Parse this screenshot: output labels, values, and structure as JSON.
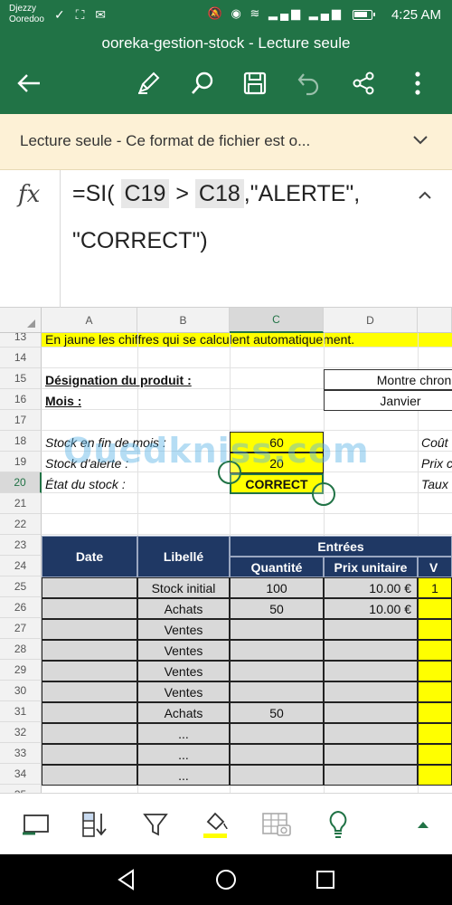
{
  "status_bar": {
    "carrier_1": "Djezzy",
    "carrier_2": "Ooredoo",
    "time": "4:25 AM",
    "battery_level": 0.8
  },
  "app_bar": {
    "title": "ooreka-gestion-stock - Lecture seule"
  },
  "banner": {
    "text": "Lecture seule - Ce format de fichier est o..."
  },
  "formula_bar": {
    "fx_label": "fx",
    "line1_prefix": "=SI(",
    "ref1": "C19",
    "operator": ">",
    "ref2": "C18",
    "line1_suffix": ",\"ALERTE\",",
    "line2": "\"CORRECT\")"
  },
  "columns": [
    "A",
    "B",
    "C",
    "D"
  ],
  "rows": [
    "13",
    "14",
    "15",
    "16",
    "17",
    "18",
    "19",
    "20",
    "21",
    "22",
    "23",
    "24",
    "25",
    "26",
    "27",
    "28",
    "29",
    "30",
    "31",
    "32",
    "33",
    "34",
    "35"
  ],
  "sheet": {
    "note": "En jaune les chiffres qui se calculent automatiquement.",
    "designation_label": "Désignation du produit :",
    "designation_value": "Montre chron",
    "mois_label": "Mois :",
    "mois_value": "Janvier",
    "stock_fin_label": "Stock en fin de mois :",
    "stock_fin_value": "60",
    "stock_alerte_label": "Stock d'alerte :",
    "stock_alerte_value": "20",
    "etat_label": "État du stock :",
    "etat_value": "CORRECT",
    "right_label_18": "Coût",
    "right_label_19": "Prix c",
    "right_label_20": "Taux"
  },
  "table": {
    "header_date": "Date",
    "header_libelle": "Libellé",
    "header_entrees": "Entrées",
    "header_quantite": "Quantité",
    "header_prix": "Prix unitaire",
    "header_v": "V",
    "rows": [
      {
        "libelle": "Stock initial",
        "quantite": "100",
        "prix": "10.00 €",
        "v": "1"
      },
      {
        "libelle": "Achats",
        "quantite": "50",
        "prix": "10.00 €",
        "v": ""
      },
      {
        "libelle": "Ventes",
        "quantite": "",
        "prix": "",
        "v": ""
      },
      {
        "libelle": "Ventes",
        "quantite": "",
        "prix": "",
        "v": ""
      },
      {
        "libelle": "Ventes",
        "quantite": "",
        "prix": "",
        "v": ""
      },
      {
        "libelle": "Ventes",
        "quantite": "",
        "prix": "",
        "v": ""
      },
      {
        "libelle": "Achats",
        "quantite": "50",
        "prix": "",
        "v": ""
      },
      {
        "libelle": "...",
        "quantite": "",
        "prix": "",
        "v": ""
      },
      {
        "libelle": "...",
        "quantite": "",
        "prix": "",
        "v": ""
      },
      {
        "libelle": "...",
        "quantite": "",
        "prix": "",
        "v": ""
      }
    ]
  },
  "watermark": "Ouedkniss.com",
  "colors": {
    "excel_green": "#217346",
    "table_header": "#1f3864",
    "highlight_yellow": "#ffff00",
    "banner_bg": "#fdf1d6"
  },
  "icons": {
    "app_bar": [
      "back-arrow-icon",
      "pen-edit-icon",
      "search-icon",
      "save-icon",
      "undo-icon",
      "share-icon",
      "more-vert-icon"
    ],
    "bottom_bar": [
      "sheet-icon",
      "sort-icon",
      "filter-icon",
      "fill-color-icon",
      "table-camera-icon",
      "lightbulb-icon",
      "expand-up-icon"
    ],
    "nav_bar": [
      "back-triangle-icon",
      "home-circle-icon",
      "recents-square-icon"
    ]
  }
}
